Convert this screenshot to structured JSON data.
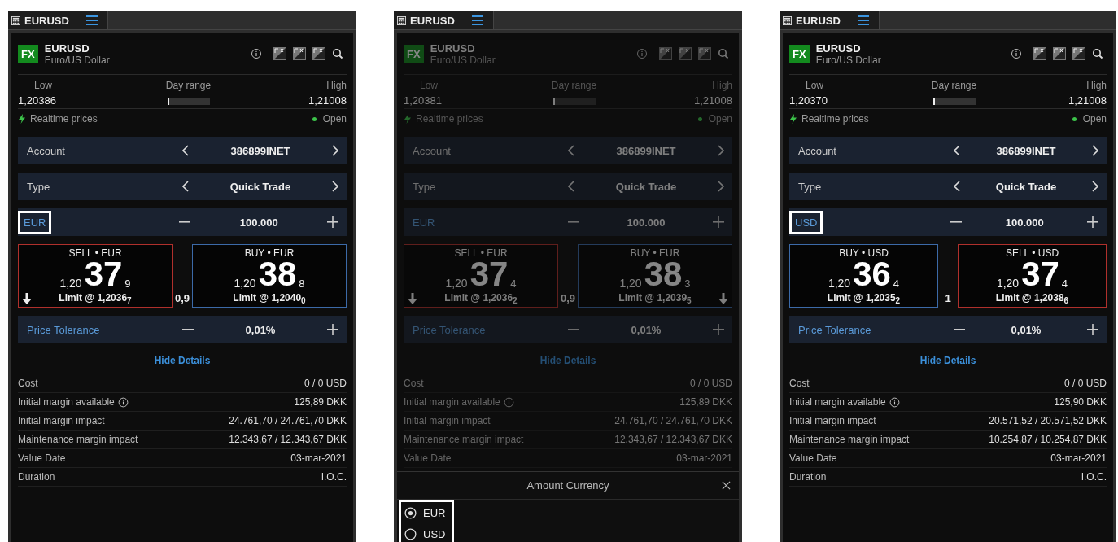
{
  "panels": [
    {
      "tab": "EURUSD",
      "badge": "FX",
      "symbol": "EURUSD",
      "name": "Euro/US Dollar",
      "low_label": "Low",
      "low": "1,20386",
      "day_range": {
        "label": "Day range",
        "level": 0.05
      },
      "high_label": "High",
      "high": "1,21008",
      "feed": "Realtime prices",
      "status": "Open",
      "dimmed": false,
      "rows": [
        {
          "kind": "choice",
          "label": "Account",
          "value": "386899INET",
          "highlighted": false
        },
        {
          "kind": "choice",
          "label": "Type",
          "value": "Quick Trade",
          "highlighted": false
        },
        {
          "kind": "stepper",
          "label": "EUR",
          "value": "100.000",
          "highlighted": true
        }
      ],
      "tiles": [
        {
          "kind": "sell",
          "title": "SELL • EUR",
          "prefix": "1,20",
          "pips": "37",
          "fraction": "9",
          "limit": "Limit @ 1,2036$_{7}$",
          "arrow": true
        },
        {
          "kind": "buy",
          "title": "BUY • EUR",
          "prefix": "1,20",
          "pips": "38",
          "fraction": "8",
          "limit": "Limit @ 1,2040$_{0}$",
          "arrow": false
        }
      ],
      "spread": "0,9",
      "tolerance": {
        "kind": "stepper",
        "label": "Price Tolerance",
        "value": "0,01%",
        "highlighted": false
      },
      "details_link": "Hide Details",
      "details": [
        {
          "label": "Cost",
          "value": "0 / 0 USD",
          "info": false
        },
        {
          "label": "Initial margin available",
          "value": "125,89 DKK",
          "info": true
        },
        {
          "label": "Initial margin impact",
          "value": "24.761,70 / 24.761,70 DKK",
          "info": false
        },
        {
          "label": "Maintenance margin impact",
          "value": "12.343,67 / 12.343,67 DKK",
          "info": false
        },
        {
          "label": "Value Date",
          "value": "03-mar-2021",
          "info": false
        },
        {
          "label": "Duration",
          "value": "I.O.C.",
          "info": false
        }
      ]
    },
    {
      "tab": "EURUSD",
      "badge": "FX",
      "symbol": "EURUSD",
      "name": "Euro/US Dollar",
      "low_label": "Low",
      "low": "1,20381",
      "day_range": {
        "label": "Day range",
        "level": 0.05
      },
      "high_label": "High",
      "high": "1,21008",
      "feed": "Realtime prices",
      "status": "Open",
      "dimmed": true,
      "rows": [
        {
          "kind": "choice",
          "label": "Account",
          "value": "386899INET",
          "highlighted": false
        },
        {
          "kind": "choice",
          "label": "Type",
          "value": "Quick Trade",
          "highlighted": false
        },
        {
          "kind": "stepper",
          "label": "EUR",
          "value": "100.000",
          "highlighted": false
        }
      ],
      "tiles": [
        {
          "kind": "sell",
          "title": "SELL • EUR",
          "prefix": "1,20",
          "pips": "37",
          "fraction": "4",
          "limit": "Limit @ 1,2036$_{2}$",
          "arrow": true
        },
        {
          "kind": "buy",
          "title": "BUY • EUR",
          "prefix": "1,20",
          "pips": "38",
          "fraction": "3",
          "limit": "Limit @ 1,2039$_{5}$",
          "arrow": true
        }
      ],
      "spread": "0,9",
      "tolerance": {
        "kind": "stepper",
        "label": "Price Tolerance",
        "value": "0,01%",
        "highlighted": false
      },
      "details_link": "Hide Details",
      "details": [
        {
          "label": "Cost",
          "value": "0 / 0 USD",
          "info": false
        },
        {
          "label": "Initial margin available",
          "value": "125,89 DKK",
          "info": true
        },
        {
          "label": "Initial margin impact",
          "value": "24.761,70 / 24.761,70 DKK",
          "info": false
        },
        {
          "label": "Maintenance margin impact",
          "value": "12.343,67 / 12.343,67 DKK",
          "info": false
        },
        {
          "label": "Value Date",
          "value": "03-mar-2021",
          "info": false
        }
      ],
      "sheet": {
        "title": "Amount Currency",
        "highlighted": true,
        "options": [
          {
            "label": "EUR",
            "selected": true
          },
          {
            "label": "USD",
            "selected": false
          }
        ]
      }
    },
    {
      "tab": "EURUSD",
      "badge": "FX",
      "symbol": "EURUSD",
      "name": "Euro/US Dollar",
      "low_label": "Low",
      "low": "1,20370",
      "day_range": {
        "label": "Day range",
        "level": 0.05
      },
      "high_label": "High",
      "high": "1,21008",
      "feed": "Realtime prices",
      "status": "Open",
      "dimmed": false,
      "rows": [
        {
          "kind": "choice",
          "label": "Account",
          "value": "386899INET",
          "highlighted": false
        },
        {
          "kind": "choice",
          "label": "Type",
          "value": "Quick Trade",
          "highlighted": false
        },
        {
          "kind": "stepper",
          "label": "USD",
          "value": "100.000",
          "highlighted": true
        }
      ],
      "tiles": [
        {
          "kind": "buy",
          "title": "BUY • USD",
          "prefix": "1,20",
          "pips": "36",
          "fraction": "4",
          "limit": "Limit @ 1,2035$_{2}$",
          "arrow": false
        },
        {
          "kind": "sell",
          "title": "SELL • USD",
          "prefix": "1,20",
          "pips": "37",
          "fraction": "4",
          "limit": "Limit @ 1,2038$_{6}$",
          "arrow": false
        }
      ],
      "spread": "1",
      "tolerance": {
        "kind": "stepper",
        "label": "Price Tolerance",
        "value": "0,01%",
        "highlighted": false
      },
      "details_link": "Hide Details",
      "details": [
        {
          "label": "Cost",
          "value": "0 / 0 USD",
          "info": false
        },
        {
          "label": "Initial margin available",
          "value": "125,90 DKK",
          "info": true
        },
        {
          "label": "Initial margin impact",
          "value": "20.571,52 / 20.571,52 DKK",
          "info": false
        },
        {
          "label": "Maintenance margin impact",
          "value": "10.254,87 / 10.254,87 DKK",
          "info": false
        },
        {
          "label": "Value Date",
          "value": "03-mar-2021",
          "info": false
        },
        {
          "label": "Duration",
          "value": "I.O.C.",
          "info": false
        }
      ]
    }
  ]
}
